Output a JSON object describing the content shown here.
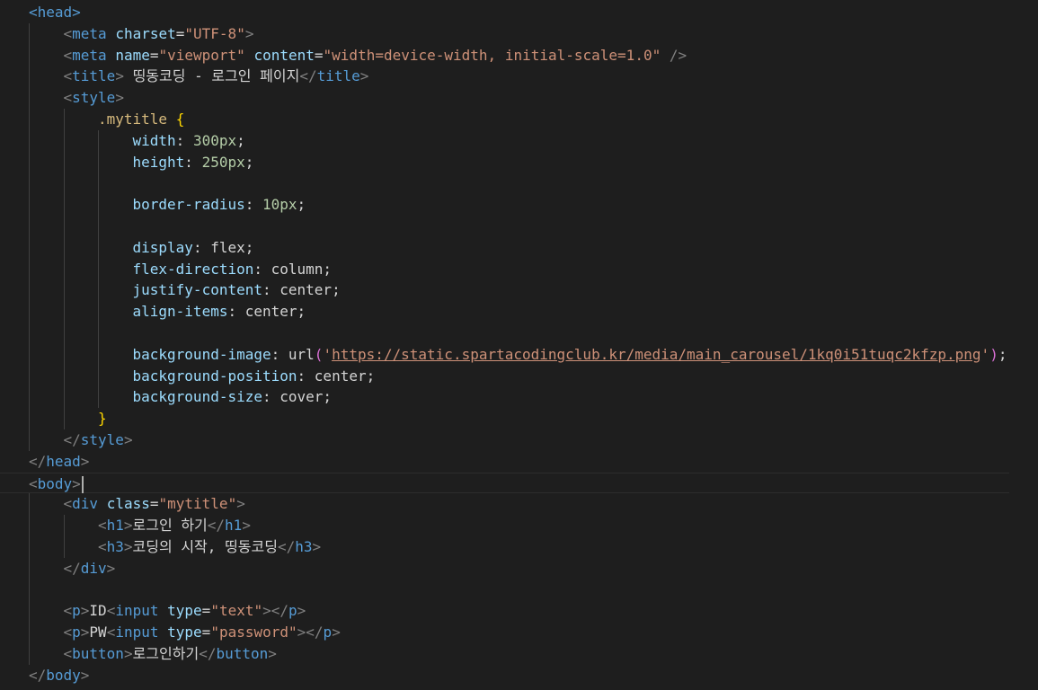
{
  "editor": {
    "lines": [
      {
        "indent": 0,
        "tokens": [
          {
            "t": "tag",
            "v": "<head>"
          }
        ]
      },
      {
        "indent": 1,
        "tokens": [
          {
            "t": "punct",
            "v": "<"
          },
          {
            "t": "tag",
            "v": "meta"
          },
          {
            "t": "text",
            "v": " "
          },
          {
            "t": "attr",
            "v": "charset"
          },
          {
            "t": "text",
            "v": "="
          },
          {
            "t": "string",
            "v": "\"UTF-8\""
          },
          {
            "t": "punct",
            "v": ">"
          }
        ]
      },
      {
        "indent": 1,
        "tokens": [
          {
            "t": "punct",
            "v": "<"
          },
          {
            "t": "tag",
            "v": "meta"
          },
          {
            "t": "text",
            "v": " "
          },
          {
            "t": "attr",
            "v": "name"
          },
          {
            "t": "text",
            "v": "="
          },
          {
            "t": "string",
            "v": "\"viewport\""
          },
          {
            "t": "text",
            "v": " "
          },
          {
            "t": "attr",
            "v": "content"
          },
          {
            "t": "text",
            "v": "="
          },
          {
            "t": "string",
            "v": "\"width=device-width, initial-scale=1.0\""
          },
          {
            "t": "text",
            "v": " "
          },
          {
            "t": "punct",
            "v": "/>"
          }
        ]
      },
      {
        "indent": 1,
        "tokens": [
          {
            "t": "punct",
            "v": "<"
          },
          {
            "t": "tag",
            "v": "title"
          },
          {
            "t": "punct",
            "v": ">"
          },
          {
            "t": "text",
            "v": " 띵동코딩 - 로그인 페이지"
          },
          {
            "t": "punct",
            "v": "</"
          },
          {
            "t": "tag",
            "v": "title"
          },
          {
            "t": "punct",
            "v": ">"
          }
        ]
      },
      {
        "indent": 1,
        "tokens": [
          {
            "t": "punct",
            "v": "<"
          },
          {
            "t": "tag",
            "v": "style"
          },
          {
            "t": "punct",
            "v": ">"
          }
        ]
      },
      {
        "indent": 2,
        "tokens": [
          {
            "t": "selector",
            "v": ".mytitle"
          },
          {
            "t": "text",
            "v": " "
          },
          {
            "t": "brace",
            "v": "{"
          }
        ]
      },
      {
        "indent": 3,
        "tokens": [
          {
            "t": "prop",
            "v": "width"
          },
          {
            "t": "text",
            "v": ": "
          },
          {
            "t": "num",
            "v": "300px"
          },
          {
            "t": "text",
            "v": ";"
          }
        ]
      },
      {
        "indent": 3,
        "tokens": [
          {
            "t": "prop",
            "v": "height"
          },
          {
            "t": "text",
            "v": ": "
          },
          {
            "t": "num",
            "v": "250px"
          },
          {
            "t": "text",
            "v": ";"
          }
        ]
      },
      {
        "indent": 0,
        "tokens": []
      },
      {
        "indent": 3,
        "tokens": [
          {
            "t": "prop",
            "v": "border-radius"
          },
          {
            "t": "text",
            "v": ": "
          },
          {
            "t": "num",
            "v": "10px"
          },
          {
            "t": "text",
            "v": ";"
          }
        ]
      },
      {
        "indent": 0,
        "tokens": []
      },
      {
        "indent": 3,
        "tokens": [
          {
            "t": "prop",
            "v": "display"
          },
          {
            "t": "text",
            "v": ": flex;"
          }
        ]
      },
      {
        "indent": 3,
        "tokens": [
          {
            "t": "prop",
            "v": "flex-direction"
          },
          {
            "t": "text",
            "v": ": column;"
          }
        ]
      },
      {
        "indent": 3,
        "tokens": [
          {
            "t": "prop",
            "v": "justify-content"
          },
          {
            "t": "text",
            "v": ": center;"
          }
        ]
      },
      {
        "indent": 3,
        "tokens": [
          {
            "t": "prop",
            "v": "align-items"
          },
          {
            "t": "text",
            "v": ": center;"
          }
        ]
      },
      {
        "indent": 0,
        "tokens": []
      },
      {
        "indent": 3,
        "tokens": [
          {
            "t": "prop",
            "v": "background-image"
          },
          {
            "t": "text",
            "v": ": url"
          },
          {
            "t": "paren",
            "v": "("
          },
          {
            "t": "string",
            "v": "'"
          },
          {
            "t": "url",
            "v": "https://static.spartacodingclub.kr/media/main_carousel/1kq0i51tuqc2kfzp.png"
          },
          {
            "t": "string",
            "v": "'"
          },
          {
            "t": "paren",
            "v": ")"
          },
          {
            "t": "text",
            "v": ";"
          }
        ]
      },
      {
        "indent": 3,
        "tokens": [
          {
            "t": "prop",
            "v": "background-position"
          },
          {
            "t": "text",
            "v": ": center;"
          }
        ]
      },
      {
        "indent": 3,
        "tokens": [
          {
            "t": "prop",
            "v": "background-size"
          },
          {
            "t": "text",
            "v": ": cover;"
          }
        ]
      },
      {
        "indent": 2,
        "tokens": [
          {
            "t": "brace",
            "v": "}"
          }
        ]
      },
      {
        "indent": 1,
        "tokens": [
          {
            "t": "punct",
            "v": "</"
          },
          {
            "t": "tag",
            "v": "style"
          },
          {
            "t": "punct",
            "v": ">"
          }
        ]
      },
      {
        "indent": 0,
        "tokens": [
          {
            "t": "punct",
            "v": "</"
          },
          {
            "t": "tag",
            "v": "head"
          },
          {
            "t": "punct",
            "v": ">"
          }
        ]
      },
      {
        "indent": 0,
        "current": true,
        "tokens": [
          {
            "t": "punct",
            "v": "<"
          },
          {
            "t": "tag",
            "v": "body"
          },
          {
            "t": "punct",
            "v": ">"
          }
        ]
      },
      {
        "indent": 1,
        "tokens": [
          {
            "t": "punct",
            "v": "<"
          },
          {
            "t": "tag",
            "v": "div"
          },
          {
            "t": "text",
            "v": " "
          },
          {
            "t": "attr",
            "v": "class"
          },
          {
            "t": "text",
            "v": "="
          },
          {
            "t": "string",
            "v": "\"mytitle\""
          },
          {
            "t": "punct",
            "v": ">"
          }
        ]
      },
      {
        "indent": 2,
        "tokens": [
          {
            "t": "punct",
            "v": "<"
          },
          {
            "t": "tag",
            "v": "h1"
          },
          {
            "t": "punct",
            "v": ">"
          },
          {
            "t": "text",
            "v": "로그인 하기"
          },
          {
            "t": "punct",
            "v": "</"
          },
          {
            "t": "tag",
            "v": "h1"
          },
          {
            "t": "punct",
            "v": ">"
          }
        ]
      },
      {
        "indent": 2,
        "tokens": [
          {
            "t": "punct",
            "v": "<"
          },
          {
            "t": "tag",
            "v": "h3"
          },
          {
            "t": "punct",
            "v": ">"
          },
          {
            "t": "text",
            "v": "코딩의 시작, 띵동코딩"
          },
          {
            "t": "punct",
            "v": "</"
          },
          {
            "t": "tag",
            "v": "h3"
          },
          {
            "t": "punct",
            "v": ">"
          }
        ]
      },
      {
        "indent": 1,
        "tokens": [
          {
            "t": "punct",
            "v": "</"
          },
          {
            "t": "tag",
            "v": "div"
          },
          {
            "t": "punct",
            "v": ">"
          }
        ]
      },
      {
        "indent": 0,
        "tokens": []
      },
      {
        "indent": 1,
        "tokens": [
          {
            "t": "punct",
            "v": "<"
          },
          {
            "t": "tag",
            "v": "p"
          },
          {
            "t": "punct",
            "v": ">"
          },
          {
            "t": "text",
            "v": "ID"
          },
          {
            "t": "punct",
            "v": "<"
          },
          {
            "t": "tag",
            "v": "input"
          },
          {
            "t": "text",
            "v": " "
          },
          {
            "t": "attr",
            "v": "type"
          },
          {
            "t": "text",
            "v": "="
          },
          {
            "t": "string",
            "v": "\"text\""
          },
          {
            "t": "punct",
            "v": "></"
          },
          {
            "t": "tag",
            "v": "p"
          },
          {
            "t": "punct",
            "v": ">"
          }
        ]
      },
      {
        "indent": 1,
        "tokens": [
          {
            "t": "punct",
            "v": "<"
          },
          {
            "t": "tag",
            "v": "p"
          },
          {
            "t": "punct",
            "v": ">"
          },
          {
            "t": "text",
            "v": "PW"
          },
          {
            "t": "punct",
            "v": "<"
          },
          {
            "t": "tag",
            "v": "input"
          },
          {
            "t": "text",
            "v": " "
          },
          {
            "t": "attr",
            "v": "type"
          },
          {
            "t": "text",
            "v": "="
          },
          {
            "t": "string",
            "v": "\"password\""
          },
          {
            "t": "punct",
            "v": "></"
          },
          {
            "t": "tag",
            "v": "p"
          },
          {
            "t": "punct",
            "v": ">"
          }
        ]
      },
      {
        "indent": 1,
        "tokens": [
          {
            "t": "punct",
            "v": "<"
          },
          {
            "t": "tag",
            "v": "button"
          },
          {
            "t": "punct",
            "v": ">"
          },
          {
            "t": "text",
            "v": "로그인하기"
          },
          {
            "t": "punct",
            "v": "</"
          },
          {
            "t": "tag",
            "v": "button"
          },
          {
            "t": "punct",
            "v": ">"
          }
        ]
      },
      {
        "indent": 0,
        "tokens": [
          {
            "t": "punct",
            "v": "</"
          },
          {
            "t": "tag",
            "v": "body"
          },
          {
            "t": "punct",
            "v": ">"
          }
        ]
      }
    ]
  }
}
